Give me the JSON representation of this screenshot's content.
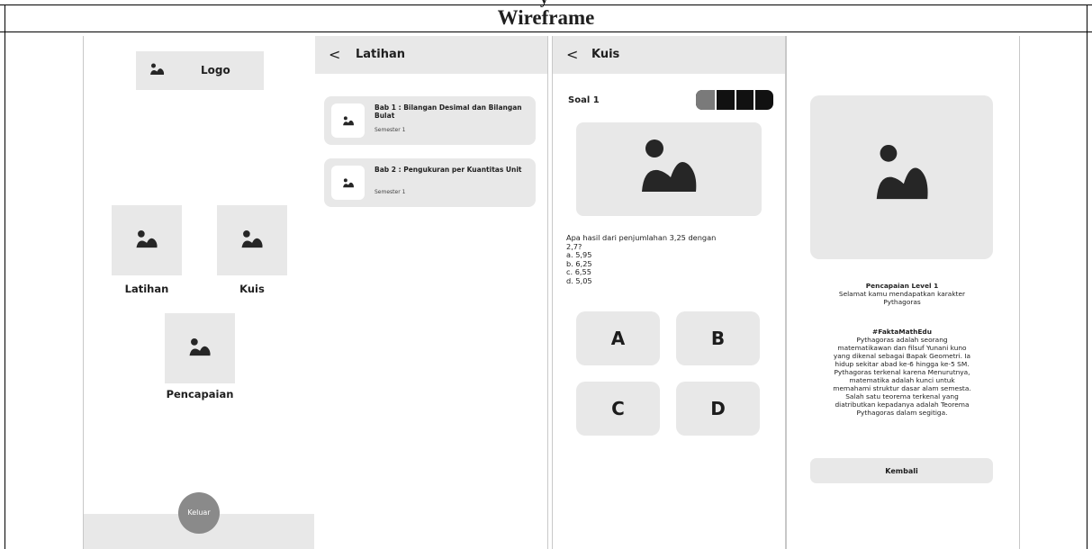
{
  "section_caption_partial": "y",
  "header_title": "Wireframe",
  "screen1": {
    "logo_label": "Logo",
    "tiles": [
      {
        "label": "Latihan"
      },
      {
        "label": "Kuis"
      },
      {
        "label": "Pencapaian"
      }
    ],
    "exit_label": "Keluar"
  },
  "screen2": {
    "back_glyph": "<",
    "title": "Latihan",
    "chapters": [
      {
        "title": "Bab 1 : Bilangan Desimal dan Bilangan Bulat",
        "subtitle": "Semester 1"
      },
      {
        "title": "Bab 2 : Pengukuran per Kuantitas Unit",
        "subtitle": "Semester 1"
      }
    ]
  },
  "screen3": {
    "back_glyph": "<",
    "title": "Kuis",
    "question_label": "Soal 1",
    "progress": {
      "completed": 1,
      "total": 4
    },
    "question_lines": [
      "Apa hasil dari penjumlahan 3,25 dengan",
      "2,7?",
      "a. 5,95",
      "b. 6,25",
      "c. 6,55",
      "d. 5,05"
    ],
    "answers": [
      "A",
      "B",
      "C",
      "D"
    ]
  },
  "screen4": {
    "achievement_title": "Pencapaian Level 1",
    "achievement_lines": [
      "Selamat kamu mendapatkan karakter",
      "Pythagoras"
    ],
    "fact_title": "#FaktaMathEdu",
    "fact_lines": [
      "Pythagoras adalah seorang",
      "matematikawan dan filsuf Yunani kuno",
      "yang dikenal sebagai Bapak Geometri. Ia",
      "hidup sekitar abad ke-6 hingga ke-5 SM.",
      "Pythagoras terkenal karena Menurutnya,",
      "matematika adalah kunci untuk",
      "memahami struktur dasar alam semesta.",
      "Salah satu teorema terkenal yang",
      "diatributkan kepadanya adalah Teorema",
      "Pythagoras dalam segitiga."
    ],
    "back_button_label": "Kembali"
  },
  "colors": {
    "placeholder_grey": "#e8e8e8",
    "icon_dark": "#262626",
    "exit_button": "#8a8a8a",
    "progress_done": "#7a7a7a",
    "progress_todo": "#111111"
  },
  "icons": {
    "placeholder": "image-placeholder-icon",
    "back": "chevron-left-icon"
  }
}
